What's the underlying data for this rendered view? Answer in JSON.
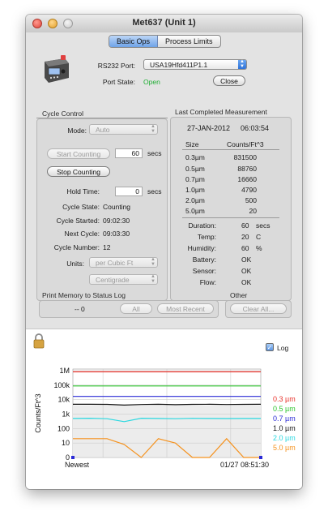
{
  "window": {
    "title": "Met637 (Unit 1)"
  },
  "tabs": [
    {
      "label": "Basic Ops",
      "active": true
    },
    {
      "label": "Process Limits",
      "active": false
    }
  ],
  "port": {
    "label": "RS232 Port:",
    "value": "USA19Hfd411P1.1",
    "state_label": "Port State:",
    "state_value": "Open",
    "state_color": "#1fae33",
    "close_button": "Close"
  },
  "cycle_control": {
    "title": "Cycle Control",
    "mode_label": "Mode:",
    "mode_value": "Auto",
    "start_button": "Start Counting",
    "start_secs_value": "60",
    "secs_unit": "secs",
    "stop_button": "Stop Counting",
    "hold_label": "Hold Time:",
    "hold_value": "0",
    "cycle_state_label": "Cycle State:",
    "cycle_state_value": "Counting",
    "cycle_started_label": "Cycle Started:",
    "cycle_started_value": "09:02:30",
    "next_cycle_label": "Next Cycle:",
    "next_cycle_value": "09:03:30",
    "cycle_number_label": "Cycle Number:",
    "cycle_number_value": "12",
    "units_label": "Units:",
    "units_value": "per Cubic Ft",
    "temp_unit_value": "Centigrade"
  },
  "measurement": {
    "title": "Last Completed Measurement",
    "date": "27-JAN-2012",
    "time": "06:03:54",
    "size_header": "Size",
    "counts_header": "Counts/Ft^3",
    "rows": [
      {
        "size": "0.3µm",
        "count": "831500"
      },
      {
        "size": "0.5µm",
        "count": "88760"
      },
      {
        "size": "0.7µm",
        "count": "16660"
      },
      {
        "size": "1.0µm",
        "count": "4790"
      },
      {
        "size": "2.0µm",
        "count": "500"
      },
      {
        "size": "5.0µm",
        "count": "20"
      }
    ],
    "duration_label": "Duration:",
    "duration_value": "60",
    "duration_unit": "secs",
    "temp_label": "Temp:",
    "temp_value": "20",
    "temp_unit": "C",
    "humidity_label": "Humidity:",
    "humidity_value": "60",
    "humidity_unit": "%",
    "battery_label": "Battery:",
    "battery_value": "OK",
    "sensor_label": "Sensor:",
    "sensor_value": "OK",
    "flow_label": "Flow:",
    "flow_value": "OK"
  },
  "print_memory": {
    "title": "Print Memory to Status Log",
    "value": "-- 0",
    "all_button": "All",
    "recent_button": "Most Recent"
  },
  "other": {
    "title": "Other",
    "clear_button": "Clear All..."
  },
  "log": {
    "label": "Log",
    "checked": true
  },
  "chart_data": {
    "type": "line",
    "ylabel": "Counts/Ft^3",
    "y_scale": "log",
    "ylim": [
      0,
      3000000
    ],
    "yticks": [
      "1M",
      "100k",
      "10k",
      "1k",
      "100",
      "10",
      "0"
    ],
    "x_labels": {
      "left": "Newest",
      "right": "01/27 08:51:30"
    },
    "grid": true,
    "legend_position": "right",
    "series": [
      {
        "name": "0.3 µm",
        "color": "#e8322b",
        "values": [
          831500,
          831500,
          831500,
          831500,
          831500,
          831500,
          831500,
          831500,
          831500,
          831500,
          831500,
          831500
        ]
      },
      {
        "name": "0.5 µm",
        "color": "#2ec42e",
        "values": [
          88760,
          88760,
          88760,
          88760,
          88760,
          88760,
          88760,
          88760,
          88760,
          88760,
          88760,
          88760
        ]
      },
      {
        "name": "0.7 µm",
        "color": "#2a2ad6",
        "values": [
          16660,
          16660,
          16660,
          16660,
          16660,
          16660,
          16660,
          16660,
          16660,
          16660,
          16660,
          16660
        ]
      },
      {
        "name": "1.0 µm",
        "color": "#111111",
        "values": [
          4790,
          4800,
          4700,
          4200,
          4600,
          4800,
          4500,
          4700,
          4800,
          4600,
          4700,
          4790
        ]
      },
      {
        "name": "2.0 µm",
        "color": "#2ad8e0",
        "values": [
          500,
          520,
          480,
          300,
          520,
          500,
          480,
          510,
          500,
          490,
          500,
          500
        ]
      },
      {
        "name": "5.0 µm",
        "color": "#f5921e",
        "values": [
          20,
          20,
          20,
          8,
          0,
          20,
          10,
          0,
          0,
          20,
          0,
          0
        ]
      }
    ]
  }
}
